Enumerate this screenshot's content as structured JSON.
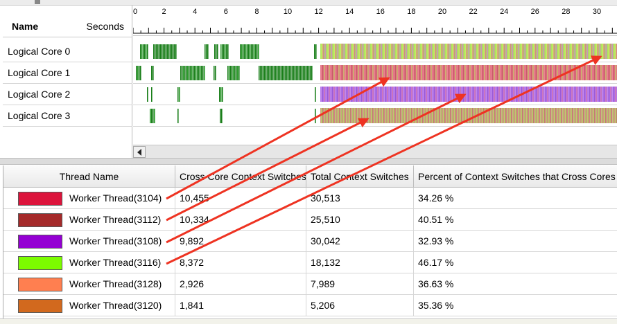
{
  "ruler": {
    "ticks": [
      "0",
      "2",
      "4",
      "6",
      "8",
      "10",
      "12",
      "14",
      "16",
      "18",
      "20",
      "22",
      "24",
      "26",
      "28",
      "30"
    ]
  },
  "name_pane": {
    "header_name": "Name",
    "header_seconds": "Seconds",
    "cores": [
      {
        "label": "Logical Core 0"
      },
      {
        "label": "Logical Core 1"
      },
      {
        "label": "Logical Core 2"
      },
      {
        "label": "Logical Core 3"
      }
    ]
  },
  "lanes": [
    {
      "gradient": "repeating-linear-gradient(90deg,#a8e060 0px,#c8f060 3px,#e07090 4px,#a8e060 6px,#d080d8 7px,#b0e050 9px)"
    },
    {
      "gradient": "repeating-linear-gradient(90deg,#e07080 0px,#f08898 2px,#c05060 3px,#e87888 5px,#b8e060 6px,#e07080 7px)"
    },
    {
      "gradient": "repeating-linear-gradient(90deg,#b070e8 0px,#c890f0 2px,#9050d0 3px,#b878f0 5px,#e07890 6px,#b070e8 7px)"
    },
    {
      "gradient": "repeating-linear-gradient(90deg,#d88088 0px,#b8e068 2px,#c06070 4px,#e8a0a0 5px,#a8d860 6px,#d08080 8px)"
    }
  ],
  "table": {
    "headers": [
      "Thread Name",
      "Cross Core Context Switches",
      "Total Context Switches",
      "Percent of Context Switches that Cross Cores"
    ],
    "rows": [
      {
        "color": "#dc143c",
        "name": "Worker Thread(3104)",
        "cross": "10,455",
        "total": "30,513",
        "percent": "34.26 %"
      },
      {
        "color": "#a52a2a",
        "name": "Worker Thread(3112)",
        "cross": "10,334",
        "total": "25,510",
        "percent": "40.51 %"
      },
      {
        "color": "#9400d3",
        "name": "Worker Thread(3108)",
        "cross": "9,892",
        "total": "30,042",
        "percent": "32.93 %"
      },
      {
        "color": "#7cfc00",
        "name": "Worker Thread(3116)",
        "cross": "8,372",
        "total": "18,132",
        "percent": "46.17 %"
      },
      {
        "color": "#ff7f50",
        "name": "Worker Thread(3128)",
        "cross": "2,926",
        "total": "7,989",
        "percent": "36.63 %"
      },
      {
        "color": "#d2691e",
        "name": "Worker Thread(3120)",
        "cross": "1,841",
        "total": "5,206",
        "percent": "35.36 %"
      }
    ]
  },
  "annotation_color": "#ee3322"
}
